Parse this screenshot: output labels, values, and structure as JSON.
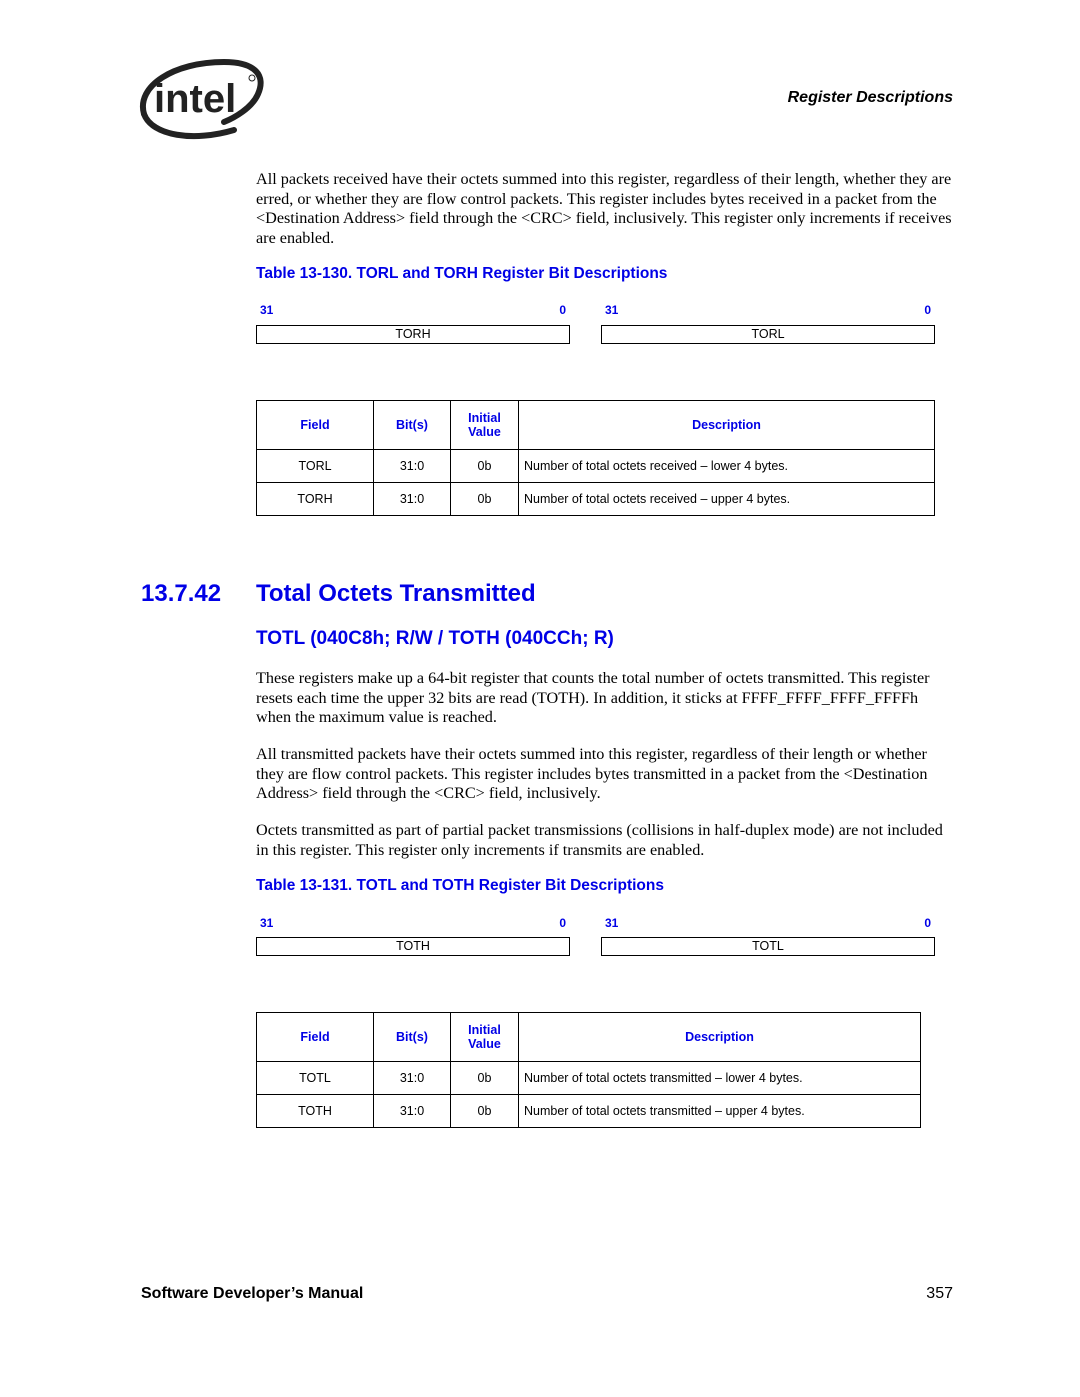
{
  "header": {
    "logo_text": "intel",
    "running_head": "Register Descriptions"
  },
  "intro_paragraph": "All packets received have their octets summed into this register, regardless of their length, whether they are erred, or whether they are flow control packets. This register includes bytes received in a packet from the <Destination Address> field through the <CRC> field, inclusively. This register only increments if receives are enabled.",
  "table_130": {
    "caption": "Table 13-130. TORL and TORH Register Bit Descriptions",
    "registers": [
      {
        "name": "TORH",
        "high_bit": "31",
        "low_bit": "0"
      },
      {
        "name": "TORL",
        "high_bit": "31",
        "low_bit": "0"
      }
    ],
    "headers": {
      "field": "Field",
      "bits": "Bit(s)",
      "initial_line1": "Initial",
      "initial_line2": "Value",
      "description": "Description"
    },
    "rows": [
      {
        "field": "TORL",
        "bits": "31:0",
        "initial": "0b",
        "description": "Number of total octets received – lower 4 bytes."
      },
      {
        "field": "TORH",
        "bits": "31:0",
        "initial": "0b",
        "description": "Number of total octets received – upper 4 bytes."
      }
    ]
  },
  "section": {
    "number": "13.7.42",
    "title": "Total Octets Transmitted",
    "subtitle": "TOTL (040C8h; R/W / TOTH (040CCh; R)",
    "paragraphs": [
      "These registers make up a 64-bit register that counts the total number of octets transmitted.   This register resets each time the upper 32 bits are read (TOTH). In addition, it sticks at FFFF_FFFF_FFFF_FFFFh when the maximum value is reached.",
      "All transmitted packets have their octets summed into this register, regardless of their length or whether they are flow control packets. This register includes bytes transmitted in a packet from the <Destination Address> field through the <CRC> field, inclusively.",
      "Octets transmitted as part of partial packet transmissions (collisions in half-duplex mode) are not included in this register. This register only increments if transmits are enabled."
    ]
  },
  "table_131": {
    "caption": "Table 13-131. TOTL and TOTH Register Bit Descriptions",
    "registers": [
      {
        "name": "TOTH",
        "high_bit": "31",
        "low_bit": "0"
      },
      {
        "name": "TOTL",
        "high_bit": "31",
        "low_bit": "0"
      }
    ],
    "headers": {
      "field": "Field",
      "bits": "Bit(s)",
      "initial_line1": "Initial",
      "initial_line2": "Value",
      "description": "Description"
    },
    "rows": [
      {
        "field": "TOTL",
        "bits": "31:0",
        "initial": "0b",
        "description": "Number of total octets transmitted – lower 4 bytes."
      },
      {
        "field": "TOTH",
        "bits": "31:0",
        "initial": "0b",
        "description": "Number of total octets transmitted – upper 4 bytes."
      }
    ]
  },
  "footer": {
    "title": "Software Developer’s Manual",
    "page_number": "357"
  },
  "colors": {
    "heading_blue": "#0000e6",
    "text": "#000000"
  }
}
